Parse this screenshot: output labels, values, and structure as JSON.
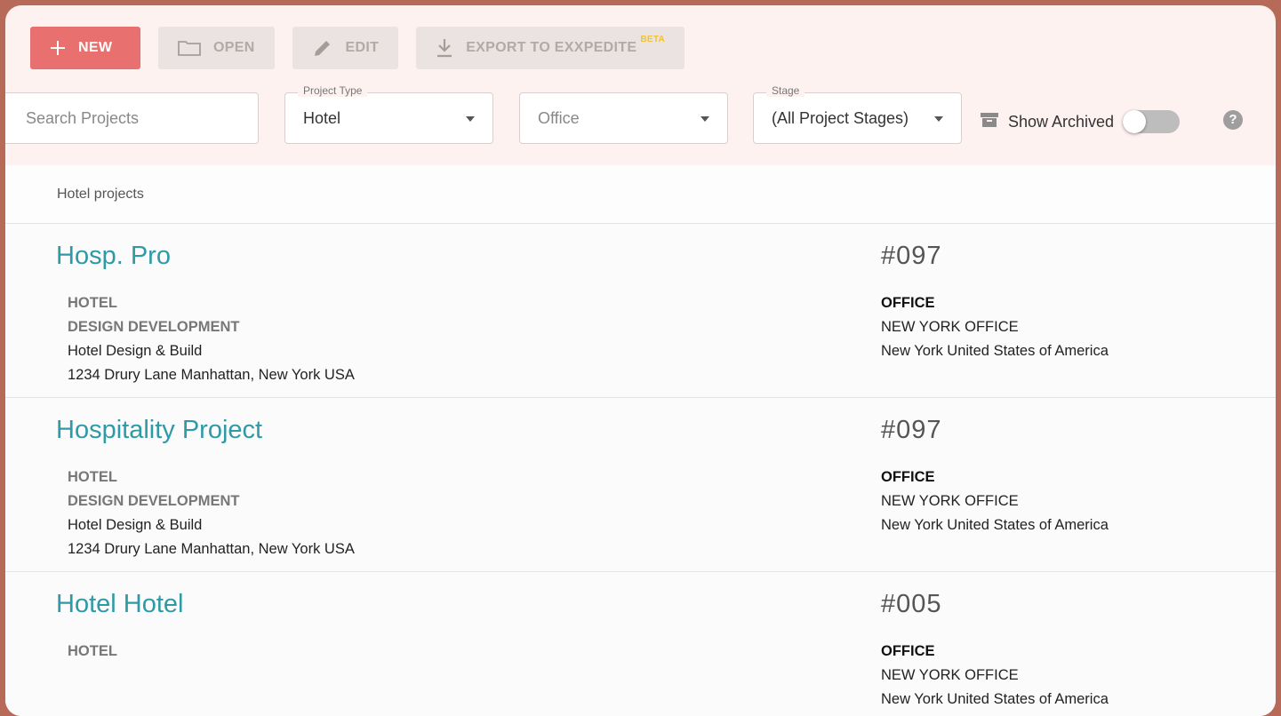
{
  "toolbar": {
    "new_label": "NEW",
    "open_label": "OPEN",
    "edit_label": "EDIT",
    "export_label": "EXPORT TO EXXPEDITE",
    "export_badge": "BETA"
  },
  "filters": {
    "search_placeholder": "Search Projects",
    "project_type_legend": "Project Type",
    "project_type_value": "Hotel",
    "office_placeholder": "Office",
    "stage_legend": "Stage",
    "stage_value": "(All Project Stages)",
    "show_archived_label": "Show Archived"
  },
  "list": {
    "header": "Hotel projects",
    "projects": [
      {
        "title": "Hosp. Pro",
        "number": "#097",
        "type": "HOTEL",
        "stage": "DESIGN DEVELOPMENT",
        "description": "Hotel Design & Build",
        "address": "1234 Drury Lane Manhattan, New York USA",
        "office_label": "OFFICE",
        "office_name": "NEW YORK OFFICE",
        "office_location": "New York United States of America"
      },
      {
        "title": "Hospitality Project",
        "number": "#097",
        "type": "HOTEL",
        "stage": "DESIGN DEVELOPMENT",
        "description": "Hotel Design & Build",
        "address": "1234 Drury Lane Manhattan, New York USA",
        "office_label": "OFFICE",
        "office_name": "NEW YORK OFFICE",
        "office_location": "New York United States of America"
      },
      {
        "title": "Hotel Hotel",
        "number": "#005",
        "type": "HOTEL",
        "office_label": "OFFICE",
        "office_name": "NEW YORK OFFICE",
        "office_location": "New York United States of America"
      }
    ]
  },
  "colors": {
    "primary": "#e8706f",
    "link": "#2e9aa6",
    "frame": "#b86a58",
    "badge": "#f0c330"
  },
  "icons": {
    "new": "plus-icon",
    "open": "folder-icon",
    "edit": "pencil-icon",
    "export": "download-icon",
    "archive": "archive-box-icon",
    "help": "help-icon"
  }
}
